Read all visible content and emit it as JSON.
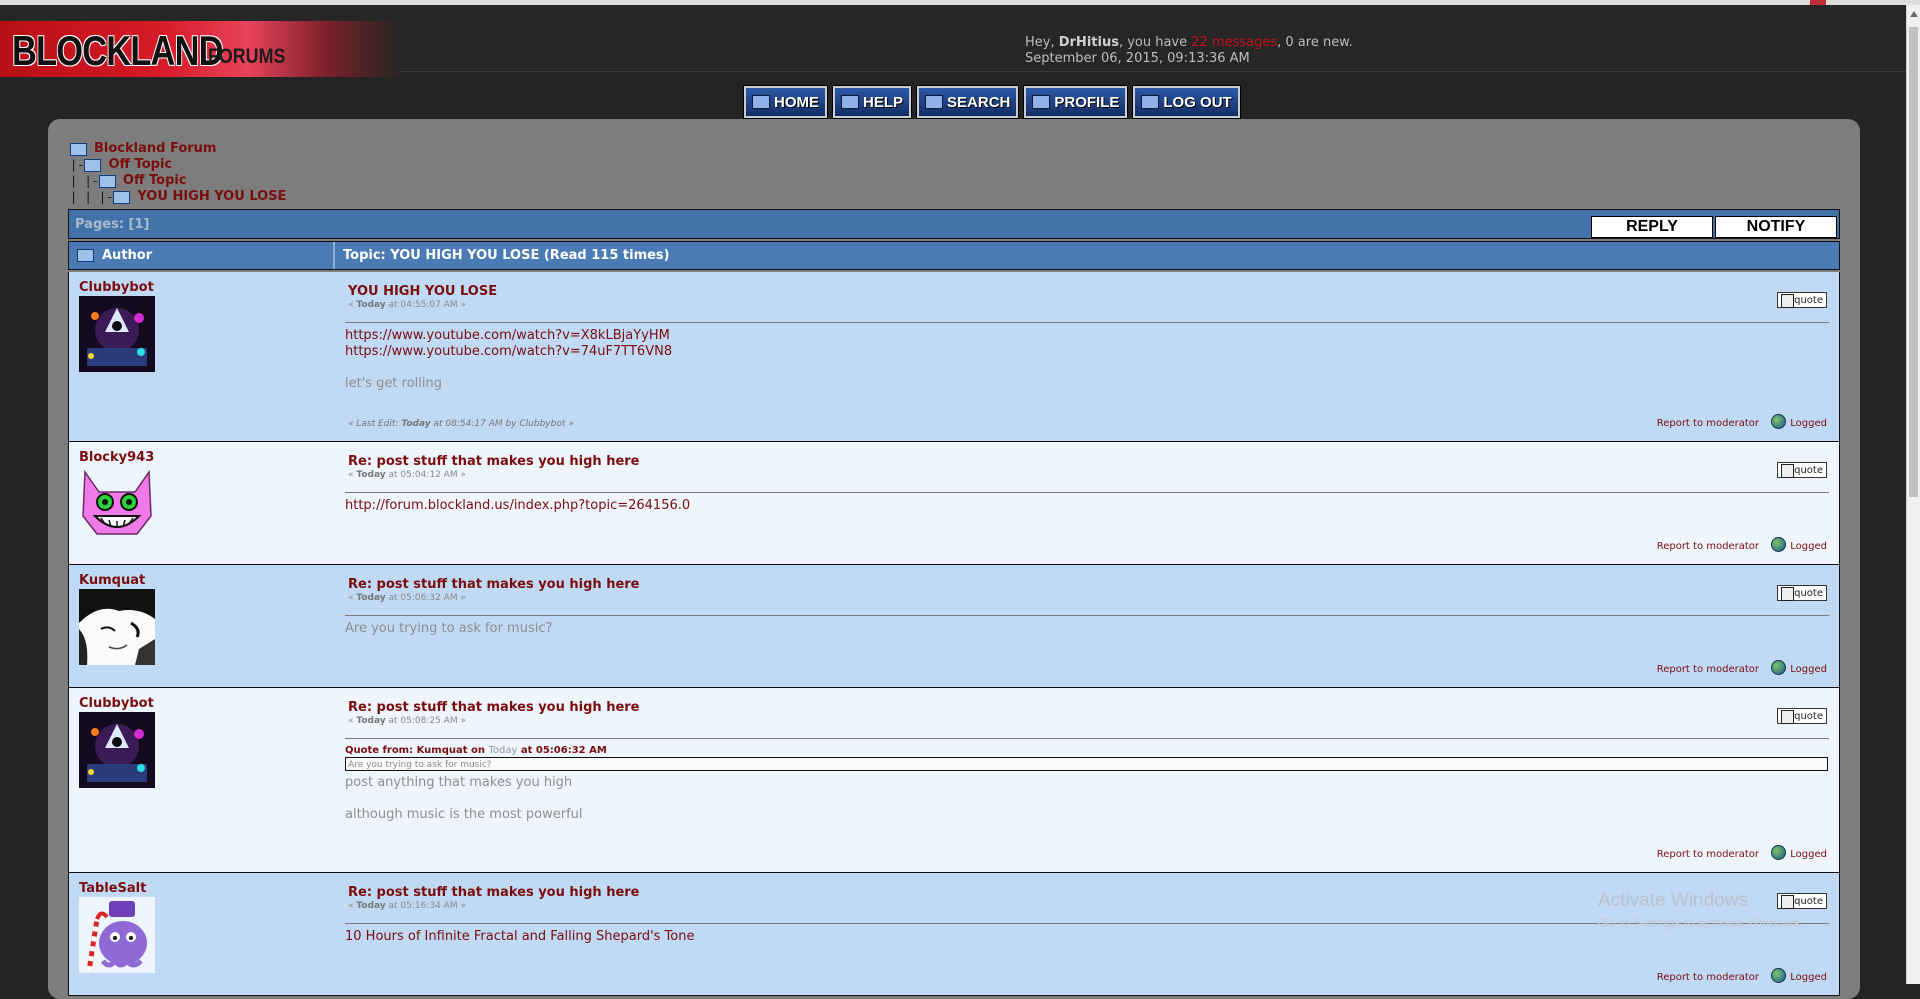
{
  "header": {
    "logo_main": "BLOCKLAND",
    "logo_sub": "FORUMS",
    "greeting_prefix": "Hey, ",
    "username": "DrHitius",
    "greeting_mid": ", you have ",
    "messages_link": "22 messages",
    "greeting_suffix": ", 0 are new.",
    "datetime": "September 06, 2015, 09:13:36 AM"
  },
  "nav": {
    "home": "HOME",
    "help": "HELP",
    "search": "SEARCH",
    "profile": "PROFILE",
    "logout": "LOG OUT"
  },
  "breadcrumb": [
    {
      "label": "Blockland Forum",
      "tree": ""
    },
    {
      "label": "Off Topic",
      "tree": "|-"
    },
    {
      "label": "Off Topic",
      "tree": "| |-"
    },
    {
      "label": "YOU HIGH YOU LOSE",
      "tree": "| | |-"
    }
  ],
  "topbar": {
    "pages": "Pages: [1]",
    "reply": "REPLY",
    "notify": "NOTIFY"
  },
  "columns": {
    "author": "Author",
    "topic": "Topic: YOU HIGH YOU LOSE  (Read 115 times)"
  },
  "post_common": {
    "quote": "quote",
    "report": "Report to moderator",
    "logged": "Logged",
    "date_prefix": "« ",
    "today": "Today",
    "date_suffix": " »"
  },
  "posts": [
    {
      "author": "Clubbybot",
      "title": "YOU HIGH YOU LOSE",
      "time": " at 04:55:07 AM",
      "links": [
        "https://www.youtube.com/watch?v=X8kLBjaYyHM",
        "https://www.youtube.com/watch?v=74uF7TT6VN8"
      ],
      "text": "let's get rolling",
      "last_edit_prefix": "« Last Edit: ",
      "last_edit_today": "Today",
      "last_edit_suffix": " at 08:54:17 AM by Clubbybot »"
    },
    {
      "author": "Blocky943",
      "title": "Re: post stuff that makes you high here",
      "time": " at 05:04:12 AM",
      "link": "http://forum.blockland.us/index.php?topic=264156.0"
    },
    {
      "author": "Kumquat",
      "title": "Re: post stuff that makes you high here",
      "time": " at 05:06:32 AM",
      "text": "Are you trying to ask for music?"
    },
    {
      "author": "Clubbybot",
      "title": "Re: post stuff that makes you high here",
      "time": " at 05:08:25 AM",
      "quote_from": "Quote from: Kumquat on ",
      "quote_today": "Today",
      "quote_at": " at 05:06:32 AM",
      "quote_text": "Are you trying to ask for music?",
      "line1": "post anything that makes you high",
      "line2": "although music is the most powerful"
    },
    {
      "author": "TableSalt",
      "title": "Re: post stuff that makes you high here",
      "time": " at 05:16:34 AM",
      "link": "10 Hours of Infinite Fractal and Falling Shepard's Tone"
    }
  ],
  "watermark": {
    "line1": "Activate Windows",
    "line2": "Go to Settings to activate Windows."
  },
  "colors": {
    "accent_red": "#7b0d0d",
    "row_blue": "#c0d9f4",
    "row_light": "#eef5fd",
    "header_blue": "#4a7bb4"
  }
}
